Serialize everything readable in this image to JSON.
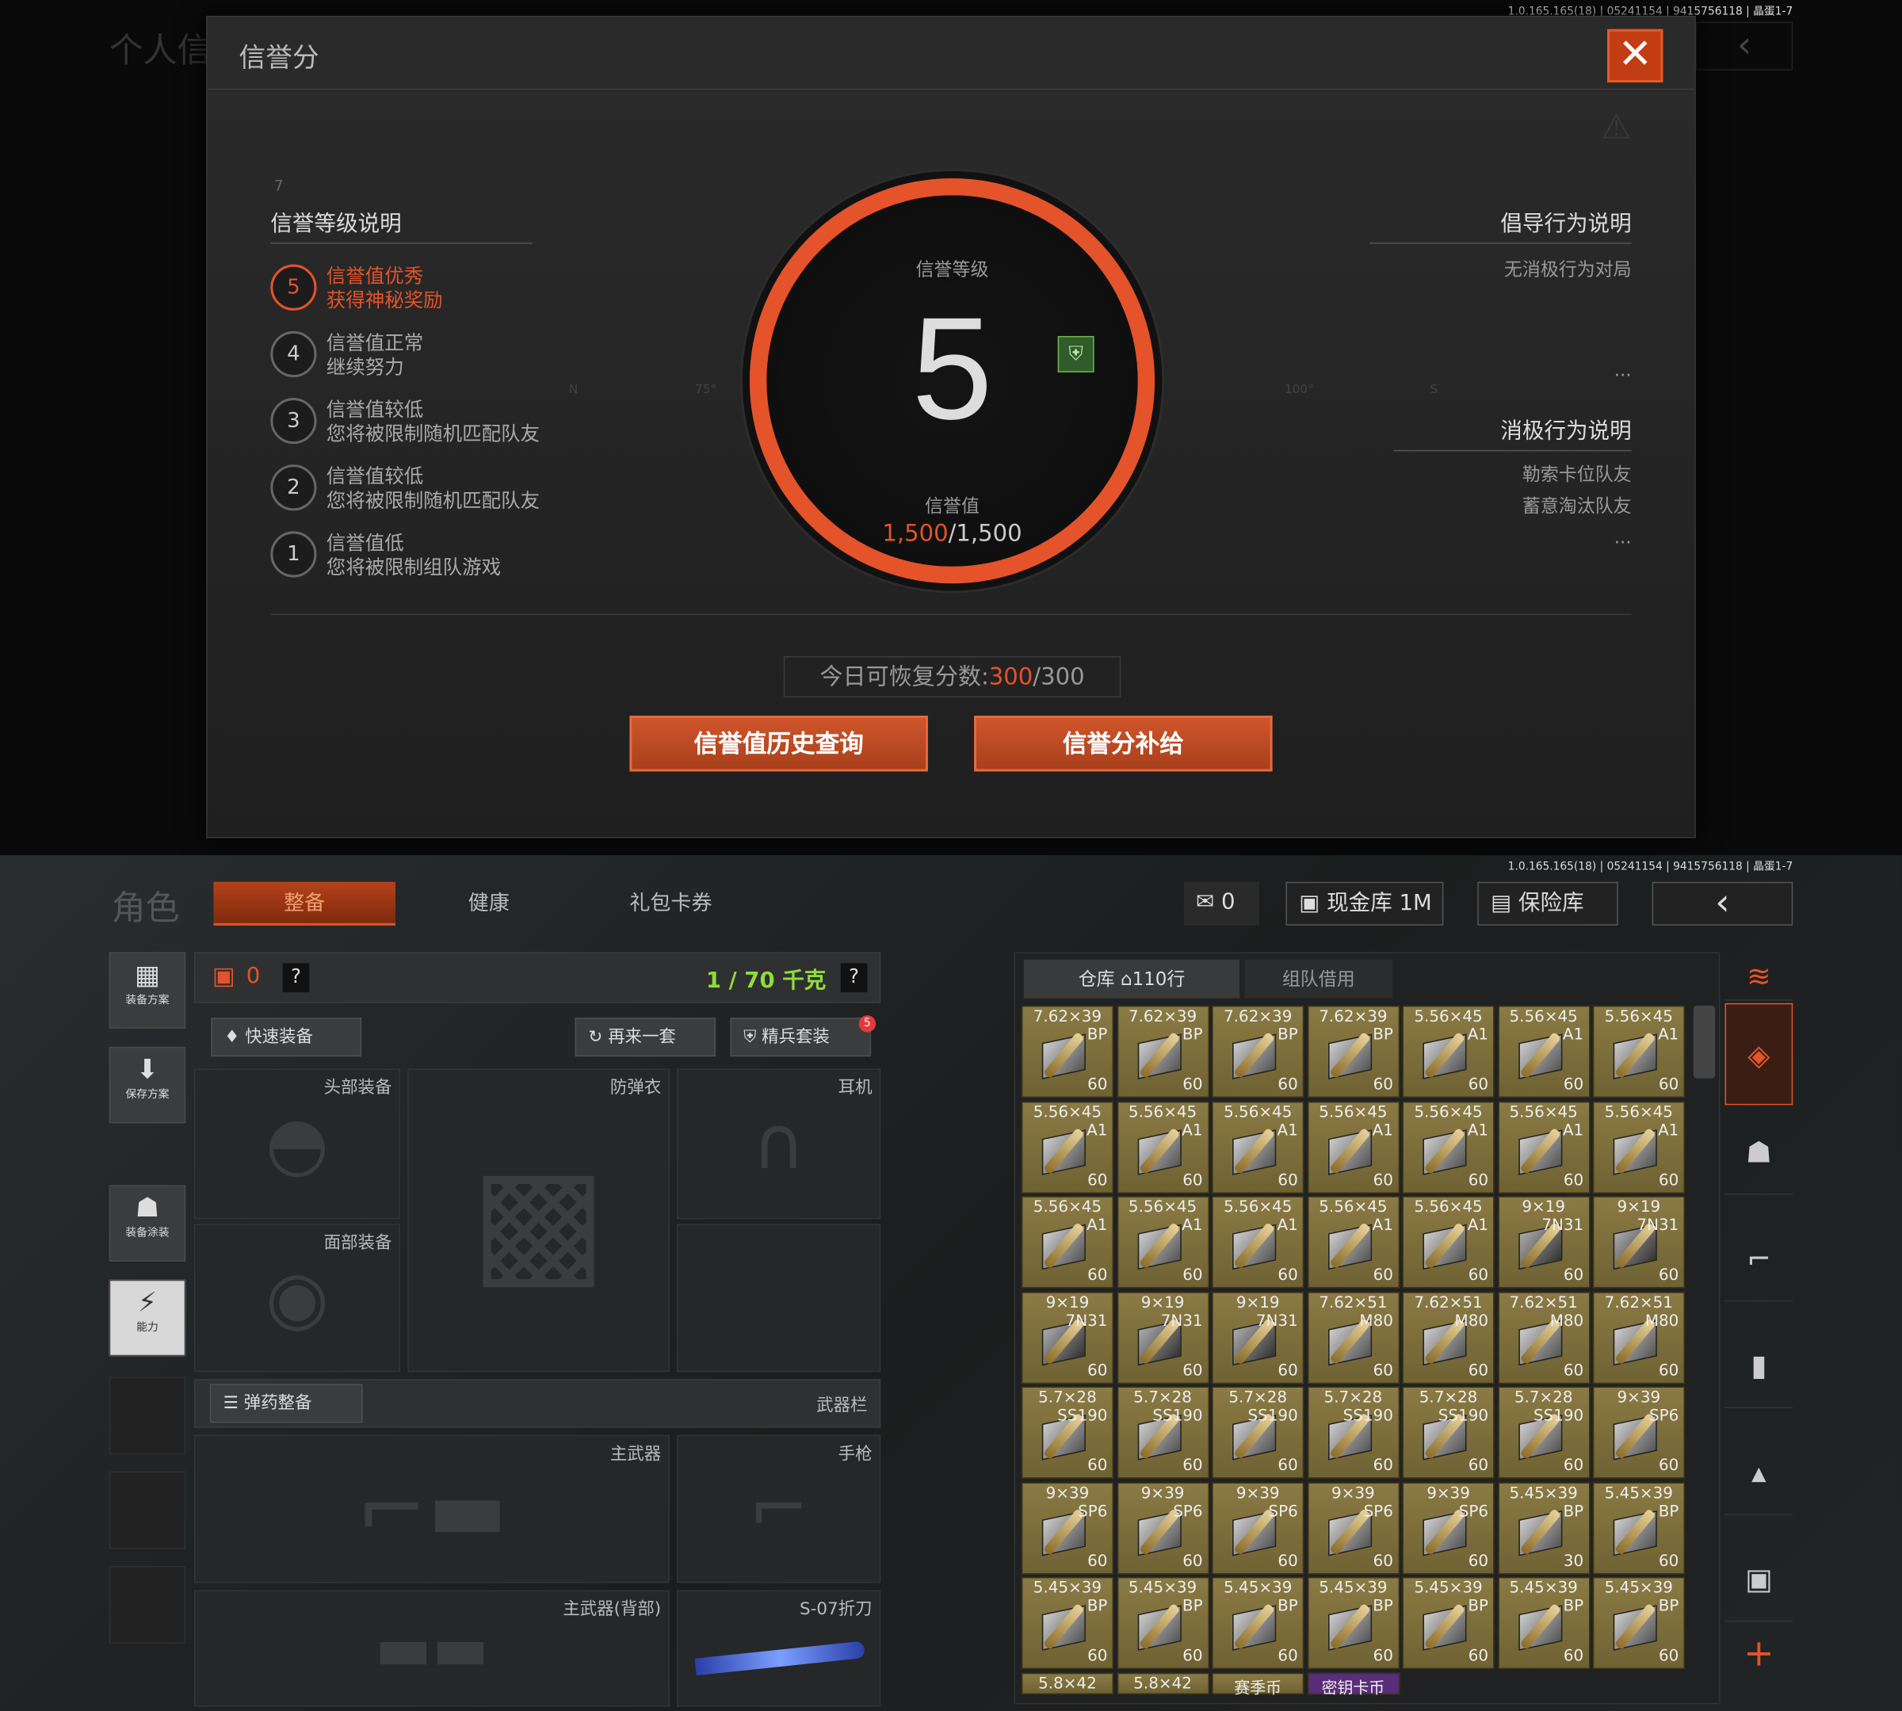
{
  "version": "1.0.165.165(18) | 05241154 | 9415756118 | 晶蛋1-7",
  "bg": {
    "title": "个人信",
    "back_glyph": "‹"
  },
  "modal": {
    "title": "信誉分",
    "close_glyph": "✕",
    "levels_header": "信誉等级说明",
    "level_index": "7",
    "levels": [
      {
        "num": "5",
        "line1": "信誉值优秀",
        "line2": "获得神秘奖励",
        "active": true
      },
      {
        "num": "4",
        "line1": "信誉值正常",
        "line2": "继续努力",
        "active": false
      },
      {
        "num": "3",
        "line1": "信誉值较低",
        "line2": "您将被限制随机匹配队友",
        "active": false
      },
      {
        "num": "2",
        "line1": "信誉值较低",
        "line2": "您将被限制随机匹配队友",
        "active": false
      },
      {
        "num": "1",
        "line1": "信誉值低",
        "line2": "您将被限制组队游戏",
        "active": false
      }
    ],
    "dial": {
      "label_level": "信誉等级",
      "level": "5",
      "label_value": "信誉值",
      "value_current": "1,500",
      "value_sep": "/",
      "value_max": "1,500",
      "compass": [
        "N",
        "75°",
        "100°",
        "S"
      ]
    },
    "positive_header": "倡导行为说明",
    "positive_items": [
      "无消极行为对局"
    ],
    "negative_header": "消极行为说明",
    "negative_items": [
      "勒索卡位队友",
      "蓄意淘汰队友"
    ],
    "ellipsis": "...",
    "recover_label": "今日可恢复分数:",
    "recover_current": "300",
    "recover_sep": "/",
    "recover_max": "300",
    "btn_history": "信誉值历史查询",
    "btn_supply": "信誉分补给"
  },
  "bottom": {
    "page_title": "角色",
    "tabs": [
      "整备",
      "健康",
      "礼包卡券"
    ],
    "currency": "0",
    "cash_vault": "现金库 1M",
    "safe": "保险库",
    "side": [
      {
        "icon": "vest-icon",
        "glyph": "▦",
        "label": "装备方案"
      },
      {
        "icon": "download-icon",
        "glyph": "⬇",
        "label": "保存方案"
      },
      {
        "icon": "helmet-paint-icon",
        "glyph": "☗",
        "label": "装备涂装"
      },
      {
        "icon": "ability-icon",
        "glyph": "⚡",
        "label": "能力"
      }
    ],
    "armor_count": "0",
    "help": "?",
    "weight": "1 / 70 千克",
    "quick_equip": "快速装备",
    "again": "再来一套",
    "elite": "精兵套装",
    "elite_badge": "5",
    "slots": {
      "head": "头部装备",
      "armor": "防弹衣",
      "ear": "耳机",
      "face": "面部装备"
    },
    "ammo_prep": "弹药整备",
    "weapon_bar": "武器栏",
    "weapons": {
      "main": "主武器",
      "pistol": "手枪",
      "main_back": "主武器(背部)",
      "knife": "S-07折刀"
    },
    "storage_tab": "仓库",
    "storage_rows": "110行",
    "team_borrow": "组队借用",
    "grid": [
      [
        [
          "7.62×39",
          "BP",
          "60"
        ],
        [
          "7.62×39",
          "BP",
          "60"
        ],
        [
          "7.62×39",
          "BP",
          "60"
        ],
        [
          "7.62×39",
          "BP",
          "60"
        ],
        [
          "5.56×45",
          "A1",
          "60"
        ],
        [
          "5.56×45",
          "A1",
          "60"
        ],
        [
          "5.56×45",
          "A1",
          "60"
        ]
      ],
      [
        [
          "5.56×45",
          "A1",
          "60"
        ],
        [
          "5.56×45",
          "A1",
          "60"
        ],
        [
          "5.56×45",
          "A1",
          "60"
        ],
        [
          "5.56×45",
          "A1",
          "60"
        ],
        [
          "5.56×45",
          "A1",
          "60"
        ],
        [
          "5.56×45",
          "A1",
          "60"
        ],
        [
          "5.56×45",
          "A1",
          "60"
        ]
      ],
      [
        [
          "5.56×45",
          "A1",
          "60"
        ],
        [
          "5.56×45",
          "A1",
          "60"
        ],
        [
          "5.56×45",
          "A1",
          "60"
        ],
        [
          "5.56×45",
          "A1",
          "60"
        ],
        [
          "5.56×45",
          "A1",
          "60"
        ],
        [
          "9×19",
          "7N31",
          "60"
        ],
        [
          "9×19",
          "7N31",
          "60"
        ]
      ],
      [
        [
          "9×19",
          "7N31",
          "60"
        ],
        [
          "9×19",
          "7N31",
          "60"
        ],
        [
          "9×19",
          "7N31",
          "60"
        ],
        [
          "7.62×51",
          "M80",
          "60"
        ],
        [
          "7.62×51",
          "M80",
          "60"
        ],
        [
          "7.62×51",
          "M80",
          "60"
        ],
        [
          "7.62×51",
          "M80",
          "60"
        ]
      ],
      [
        [
          "5.7×28",
          "SS190",
          "60"
        ],
        [
          "5.7×28",
          "SS190",
          "60"
        ],
        [
          "5.7×28",
          "SS190",
          "60"
        ],
        [
          "5.7×28",
          "SS190",
          "60"
        ],
        [
          "5.7×28",
          "SS190",
          "60"
        ],
        [
          "5.7×28",
          "SS190",
          "60"
        ],
        [
          "9×39",
          "SP6",
          "60"
        ]
      ],
      [
        [
          "9×39",
          "SP6",
          "60"
        ],
        [
          "9×39",
          "SP6",
          "60"
        ],
        [
          "9×39",
          "SP6",
          "60"
        ],
        [
          "9×39",
          "SP6",
          "60"
        ],
        [
          "9×39",
          "SP6",
          "60"
        ],
        [
          "5.45×39",
          "BP",
          "30"
        ],
        [
          "5.45×39",
          "BP",
          "60"
        ]
      ],
      [
        [
          "5.45×39",
          "BP",
          "60"
        ],
        [
          "5.45×39",
          "BP",
          "60"
        ],
        [
          "5.45×39",
          "BP",
          "60"
        ],
        [
          "5.45×39",
          "BP",
          "60"
        ],
        [
          "5.45×39",
          "BP",
          "60"
        ],
        [
          "5.45×39",
          "BP",
          "60"
        ],
        [
          "5.45×39",
          "BP",
          "60"
        ]
      ]
    ],
    "last_row": [
      "5.8×42",
      "5.8×42",
      "赛季币",
      "密钥卡币"
    ],
    "right_tools": [
      {
        "icon": "sort-icon",
        "glyph": "≋"
      },
      {
        "icon": "ammo-category-icon",
        "glyph": "◈"
      },
      {
        "icon": "helmet-category-icon",
        "glyph": "☗"
      },
      {
        "icon": "rifle-category-icon",
        "glyph": "⌐"
      },
      {
        "icon": "magazine-category-icon",
        "glyph": "▮"
      },
      {
        "icon": "bullet-category-icon",
        "glyph": "▴"
      },
      {
        "icon": "vest-category-icon",
        "glyph": "▣"
      },
      {
        "icon": "add-icon",
        "glyph": "+"
      }
    ],
    "colors": {
      "accent": "#e4532a",
      "weight": "#8fdb3a",
      "cell": "#7d6f3d"
    }
  }
}
